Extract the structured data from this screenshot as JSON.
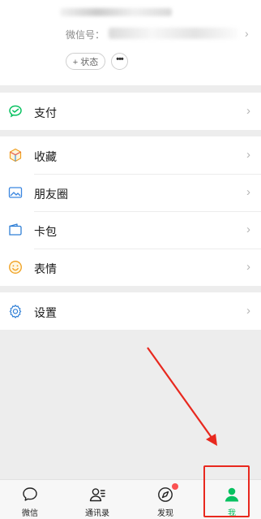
{
  "profile": {
    "wechat_id_label": "微信号：",
    "chevron": "›",
    "status_button": "+ 状态",
    "more_button": "•••"
  },
  "menu": {
    "pay": {
      "label": "支付",
      "icon": "wechat-pay-icon"
    },
    "favorites": {
      "label": "收藏",
      "icon": "favorites-cube-icon"
    },
    "moments": {
      "label": "朋友圈",
      "icon": "moments-photo-icon"
    },
    "cards": {
      "label": "卡包",
      "icon": "card-wallet-icon"
    },
    "stickers": {
      "label": "表情",
      "icon": "smiley-icon"
    },
    "settings": {
      "label": "设置",
      "icon": "gear-icon"
    },
    "chevron": "›"
  },
  "tabbar": {
    "tabs": [
      {
        "label": "微信",
        "icon": "chat-bubble-icon",
        "active": false
      },
      {
        "label": "通讯录",
        "icon": "contacts-icon",
        "active": false
      },
      {
        "label": "发现",
        "icon": "compass-icon",
        "active": false,
        "badge_dot": true
      },
      {
        "label": "我",
        "icon": "person-icon",
        "active": true
      }
    ]
  },
  "colors": {
    "accent_green": "#07c160",
    "annotation_red": "#e8281e",
    "badge_red": "#fa5151",
    "background": "#ededed"
  }
}
